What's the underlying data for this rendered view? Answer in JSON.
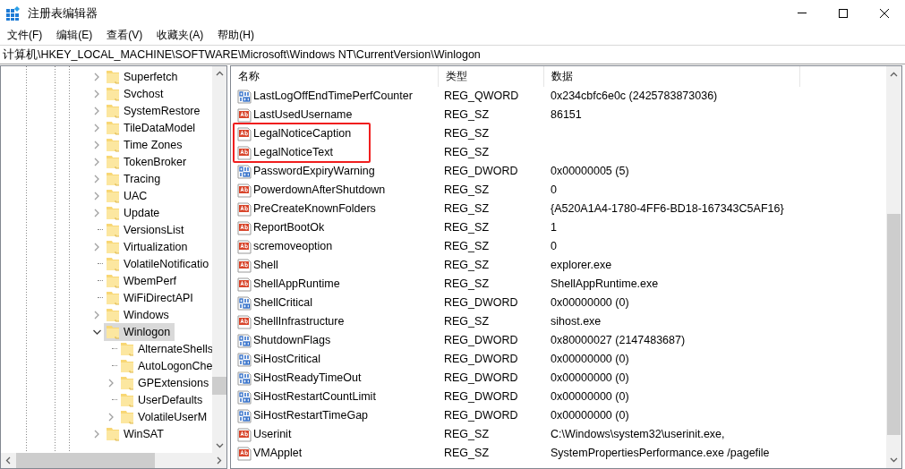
{
  "window": {
    "title": "注册表编辑器"
  },
  "menu": [
    "文件(F)",
    "编辑(E)",
    "查看(V)",
    "收藏夹(A)",
    "帮助(H)"
  ],
  "address": "计算机\\HKEY_LOCAL_MACHINE\\SOFTWARE\\Microsoft\\Windows NT\\CurrentVersion\\Winlogon",
  "tree": [
    {
      "label": "Superfetch",
      "expandable": true,
      "expanded": false,
      "selected": false
    },
    {
      "label": "Svchost",
      "expandable": true,
      "expanded": false,
      "selected": false
    },
    {
      "label": "SystemRestore",
      "expandable": true,
      "expanded": false,
      "selected": false
    },
    {
      "label": "TileDataModel",
      "expandable": true,
      "expanded": false,
      "selected": false
    },
    {
      "label": "Time Zones",
      "expandable": true,
      "expanded": false,
      "selected": false
    },
    {
      "label": "TokenBroker",
      "expandable": true,
      "expanded": false,
      "selected": false
    },
    {
      "label": "Tracing",
      "expandable": true,
      "expanded": false,
      "selected": false
    },
    {
      "label": "UAC",
      "expandable": true,
      "expanded": false,
      "selected": false
    },
    {
      "label": "Update",
      "expandable": true,
      "expanded": false,
      "selected": false
    },
    {
      "label": "VersionsList",
      "expandable": false,
      "selected": false
    },
    {
      "label": "Virtualization",
      "expandable": true,
      "expanded": false,
      "selected": false
    },
    {
      "label": "VolatileNotificatio",
      "expandable": false,
      "selected": false
    },
    {
      "label": "WbemPerf",
      "expandable": false,
      "selected": false
    },
    {
      "label": "WiFiDirectAPI",
      "expandable": false,
      "selected": false
    },
    {
      "label": "Windows",
      "expandable": true,
      "expanded": false,
      "selected": false
    },
    {
      "label": "Winlogon",
      "expandable": true,
      "expanded": true,
      "selected": true,
      "children": [
        {
          "label": "AlternateShells",
          "expandable": false,
          "selected": false
        },
        {
          "label": "AutoLogonChe",
          "expandable": false,
          "selected": false
        },
        {
          "label": "GPExtensions",
          "expandable": true,
          "expanded": false,
          "selected": false
        },
        {
          "label": "UserDefaults",
          "expandable": false,
          "selected": false
        },
        {
          "label": "VolatileUserM",
          "expandable": true,
          "expanded": false,
          "selected": false
        }
      ]
    },
    {
      "label": "WinSAT",
      "expandable": true,
      "expanded": false,
      "selected": false
    }
  ],
  "table": {
    "columns": [
      "名称",
      "类型",
      "数据"
    ],
    "rows": [
      {
        "kind": "binary",
        "name": "LastLogOffEndTimePerfCounter",
        "type": "REG_QWORD",
        "data": "0x234cbfc6e0c (2425783873036)",
        "boxed": false
      },
      {
        "kind": "string",
        "name": "LastUsedUsername",
        "type": "REG_SZ",
        "data": "86151",
        "boxed": false
      },
      {
        "kind": "string",
        "name": "LegalNoticeCaption",
        "type": "REG_SZ",
        "boxed": true
      },
      {
        "kind": "string",
        "name": "LegalNoticeText",
        "type": "REG_SZ",
        "boxed": true
      },
      {
        "kind": "binary",
        "name": "PasswordExpiryWarning",
        "type": "REG_DWORD",
        "data": "0x00000005 (5)",
        "boxed": false
      },
      {
        "kind": "string",
        "name": "PowerdownAfterShutdown",
        "type": "REG_SZ",
        "data": "0",
        "boxed": false
      },
      {
        "kind": "string",
        "name": "PreCreateKnownFolders",
        "type": "REG_SZ",
        "data": "{A520A1A4-1780-4FF6-BD18-167343C5AF16}",
        "boxed": false
      },
      {
        "kind": "string",
        "name": "ReportBootOk",
        "type": "REG_SZ",
        "data": "1",
        "boxed": false
      },
      {
        "kind": "string",
        "name": "scremoveoption",
        "type": "REG_SZ",
        "data": "0",
        "boxed": false
      },
      {
        "kind": "string",
        "name": "Shell",
        "type": "REG_SZ",
        "data": "explorer.exe",
        "boxed": false
      },
      {
        "kind": "string",
        "name": "ShellAppRuntime",
        "type": "REG_SZ",
        "data": "ShellAppRuntime.exe",
        "boxed": false
      },
      {
        "kind": "binary",
        "name": "ShellCritical",
        "type": "REG_DWORD",
        "data": "0x00000000 (0)",
        "boxed": false
      },
      {
        "kind": "string",
        "name": "ShellInfrastructure",
        "type": "REG_SZ",
        "data": "sihost.exe",
        "boxed": false
      },
      {
        "kind": "binary",
        "name": "ShutdownFlags",
        "type": "REG_DWORD",
        "data": "0x80000027 (2147483687)",
        "boxed": false
      },
      {
        "kind": "binary",
        "name": "SiHostCritical",
        "type": "REG_DWORD",
        "data": "0x00000000 (0)",
        "boxed": false
      },
      {
        "kind": "binary",
        "name": "SiHostReadyTimeOut",
        "type": "REG_DWORD",
        "data": "0x00000000 (0)",
        "boxed": false
      },
      {
        "kind": "binary",
        "name": "SiHostRestartCountLimit",
        "type": "REG_DWORD",
        "data": "0x00000000 (0)",
        "boxed": false
      },
      {
        "kind": "binary",
        "name": "SiHostRestartTimeGap",
        "type": "REG_DWORD",
        "data": "0x00000000 (0)",
        "boxed": false
      },
      {
        "kind": "string",
        "name": "Userinit",
        "type": "REG_SZ",
        "data": "C:\\Windows\\system32\\userinit.exe,",
        "boxed": false
      },
      {
        "kind": "string",
        "name": "VMApplet",
        "type": "REG_SZ",
        "data": "SystemPropertiesPerformance.exe /pagefile",
        "boxed": false
      }
    ]
  }
}
